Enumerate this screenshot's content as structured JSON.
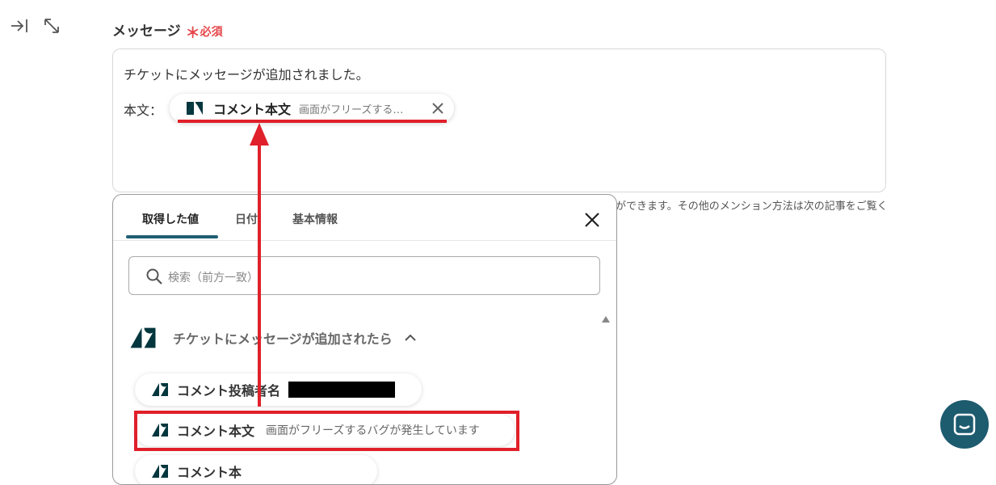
{
  "toolbar": {
    "collapse_icon": "collapse-right-icon",
    "expand_icon": "expand-diagonal-icon"
  },
  "field": {
    "label": "メッセージ",
    "required_star": "＊",
    "required_text": "必須"
  },
  "editor": {
    "line1": "チケットにメッセージが追加されました。",
    "body_label": "本文：",
    "chip": {
      "icon": "zendesk-icon",
      "title": "コメント本文",
      "value": "画面がフリーズする…"
    }
  },
  "hint_text": "ができます。その他のメンション方法は次の記事をご覧く",
  "picker": {
    "tabs": [
      {
        "label": "取得した値"
      },
      {
        "label": "日付"
      },
      {
        "label": "基本情報"
      }
    ],
    "search_placeholder": "検索（前方一致）",
    "group": {
      "title": "チケットにメッセージが追加されたら"
    },
    "items": [
      {
        "title": "コメント投稿者名",
        "value": ""
      },
      {
        "title": "コメント本文",
        "value": "画面がフリーズするバグが発生しています"
      },
      {
        "title": "コメント本"
      }
    ]
  },
  "colors": {
    "accent": "#1f5f73",
    "required": "#e5484d",
    "annotation": "#e0202a",
    "chat_button": "#1d5b6f"
  }
}
